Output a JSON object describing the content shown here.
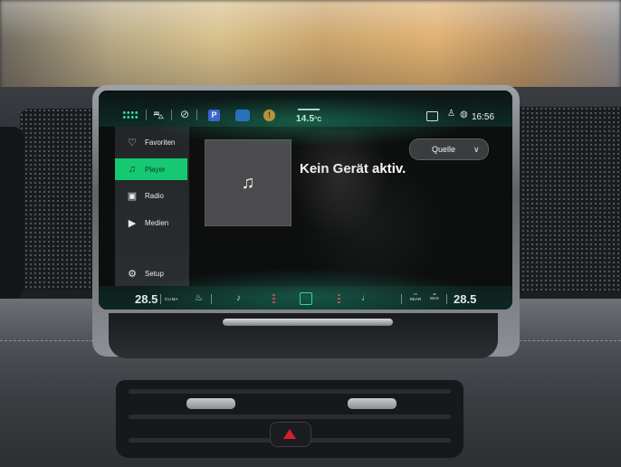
{
  "status_bar": {
    "apps_icon": "apps-grid-icon",
    "outside_temp": "14.5",
    "outside_temp_unit": "°C",
    "clock": "16:56",
    "parking_label": "P"
  },
  "sidebar": {
    "items": [
      {
        "label": "Favoriten",
        "icon": "heart-icon",
        "glyph": "♡"
      },
      {
        "label": "Player",
        "icon": "music-note-icon",
        "glyph": "♫",
        "active": true
      },
      {
        "label": "Radio",
        "icon": "radio-icon",
        "glyph": "▣"
      },
      {
        "label": "Medien",
        "icon": "play-circle-icon",
        "glyph": "▶"
      },
      {
        "label": "Setup",
        "icon": "gear-icon",
        "glyph": "⚙"
      }
    ]
  },
  "player": {
    "message": "Kein Gerät aktiv.",
    "album_placeholder_glyph": "♫"
  },
  "source_button": {
    "label": "Quelle",
    "chevron": "∨"
  },
  "climate": {
    "left_temp": "28.5",
    "right_temp": "28.5",
    "clima_label": "CLIMA",
    "rear_label": "REAR",
    "max_label": "MAX"
  },
  "colors": {
    "accent": "#17c873",
    "parking_chip": "#3a57d8",
    "warning": "#e38520",
    "heat_indicator": "#e02a3a"
  }
}
